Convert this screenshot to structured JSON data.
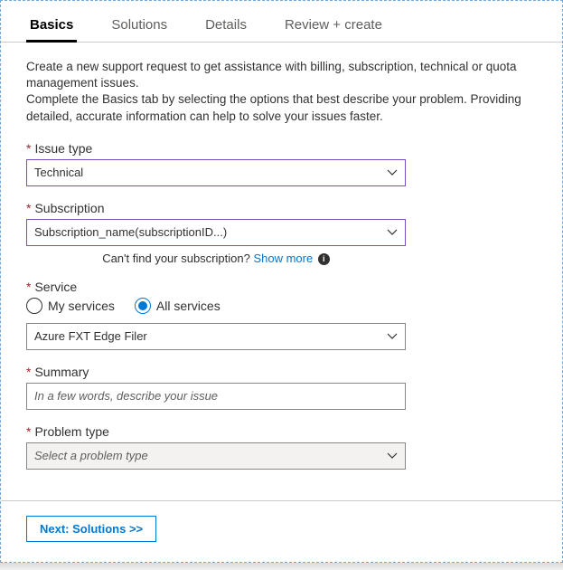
{
  "tabs": {
    "basics": "Basics",
    "solutions": "Solutions",
    "details": "Details",
    "review": "Review + create"
  },
  "intro": "Create a new support request to get assistance with billing, subscription, technical or quota management issues.\nComplete the Basics tab by selecting the options that best describe your problem. Providing detailed, accurate information can help to solve your issues faster.",
  "issueType": {
    "label": "Issue type",
    "value": "Technical"
  },
  "subscription": {
    "label": "Subscription",
    "value": "Subscription_name(subscriptionID...)",
    "helperPrefix": "Can't find your subscription? ",
    "helperLink": "Show more"
  },
  "service": {
    "label": "Service",
    "options": {
      "my": "My services",
      "all": "All services"
    },
    "value": "Azure FXT Edge Filer"
  },
  "summary": {
    "label": "Summary",
    "placeholder": "In a few words, describe your issue"
  },
  "problemType": {
    "label": "Problem type",
    "placeholder": "Select a problem type"
  },
  "footer": {
    "next": "Next: Solutions >>"
  }
}
